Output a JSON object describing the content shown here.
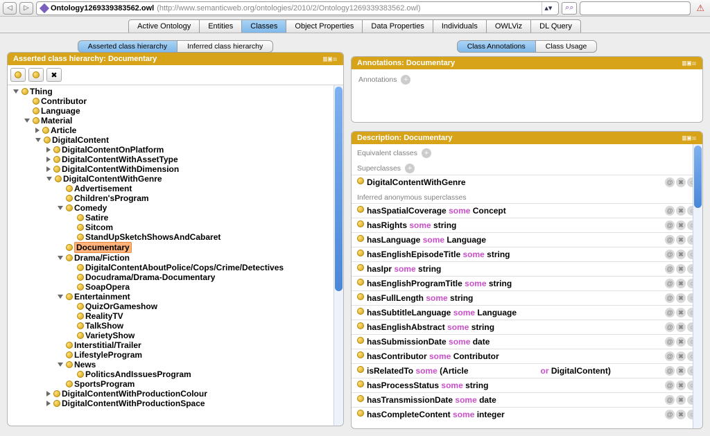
{
  "topbar": {
    "title": "Ontology1269339383562.owl",
    "uri": "(http://www.semanticweb.org/ontologies/2010/2/Ontology1269339383562.owl)"
  },
  "main_tabs": [
    "Active Ontology",
    "Entities",
    "Classes",
    "Object Properties",
    "Data Properties",
    "Individuals",
    "OWLViz",
    "DL Query"
  ],
  "main_tab_selected": 2,
  "left": {
    "subtabs": [
      "Asserted class hierarchy",
      "Inferred class hierarchy"
    ],
    "subtab_selected": 0,
    "panel_title": "Asserted class hierarchy: Documentary",
    "selected": "Documentary",
    "tree": [
      {
        "l": "Thing",
        "d": "open",
        "c": [
          {
            "l": "Contributor",
            "d": "none"
          },
          {
            "l": "Language",
            "d": "none"
          },
          {
            "l": "Material",
            "d": "open",
            "c": [
              {
                "l": "Article",
                "d": "closed"
              },
              {
                "l": "DigitalContent",
                "d": "open",
                "c": [
                  {
                    "l": "DigitalContentOnPlatform",
                    "d": "closed"
                  },
                  {
                    "l": "DigitalContentWithAssetType",
                    "d": "closed"
                  },
                  {
                    "l": "DigitalContentWithDimension",
                    "d": "closed"
                  },
                  {
                    "l": "DigitalContentWithGenre",
                    "d": "open",
                    "c": [
                      {
                        "l": "Advertisement",
                        "d": "none"
                      },
                      {
                        "l": "Children'sProgram",
                        "d": "none"
                      },
                      {
                        "l": "Comedy",
                        "d": "open",
                        "c": [
                          {
                            "l": "Satire",
                            "d": "none"
                          },
                          {
                            "l": "Sitcom",
                            "d": "none"
                          },
                          {
                            "l": "StandUpSketchShowsAndCabaret",
                            "d": "none"
                          }
                        ]
                      },
                      {
                        "l": "Documentary",
                        "d": "none",
                        "sel": true
                      },
                      {
                        "l": "Drama/Fiction",
                        "d": "open",
                        "c": [
                          {
                            "l": "DigitalContentAboutPolice/Cops/Crime/Detectives",
                            "d": "none"
                          },
                          {
                            "l": "Docudrama/Drama-Documentary",
                            "d": "none"
                          },
                          {
                            "l": "SoapOpera",
                            "d": "none"
                          }
                        ]
                      },
                      {
                        "l": "Entertainment",
                        "d": "open",
                        "c": [
                          {
                            "l": "QuizOrGameshow",
                            "d": "none"
                          },
                          {
                            "l": "RealityTV",
                            "d": "none"
                          },
                          {
                            "l": "TalkShow",
                            "d": "none"
                          },
                          {
                            "l": "VarietyShow",
                            "d": "none"
                          }
                        ]
                      },
                      {
                        "l": "Interstitial/Trailer",
                        "d": "none"
                      },
                      {
                        "l": "LifestyleProgram",
                        "d": "none"
                      },
                      {
                        "l": "News",
                        "d": "open",
                        "c": [
                          {
                            "l": "PoliticsAndIssuesProgram",
                            "d": "none"
                          }
                        ]
                      },
                      {
                        "l": "SportsProgram",
                        "d": "none"
                      }
                    ]
                  },
                  {
                    "l": "DigitalContentWithProductionColour",
                    "d": "closed"
                  },
                  {
                    "l": "DigitalContentWithProductionSpace",
                    "d": "closed"
                  }
                ]
              }
            ]
          }
        ]
      }
    ]
  },
  "right": {
    "subtabs": [
      "Class Annotations",
      "Class Usage"
    ],
    "subtab_selected": 0,
    "annot_title": "Annotations: Documentary",
    "annot_section": "Annotations",
    "desc_title": "Description: Documentary",
    "sect_eq": "Equivalent classes",
    "sect_sup": "Superclasses",
    "superclasses": [
      "DigitalContentWithGenre"
    ],
    "sect_inf": "Inferred anonymous superclasses",
    "inferred": [
      [
        [
          "p",
          "hasSpatialCoverage"
        ],
        [
          "k",
          "some"
        ],
        [
          "t",
          "Concept"
        ]
      ],
      [
        [
          "p",
          "hasRights"
        ],
        [
          "k",
          "some"
        ],
        [
          "t",
          "string"
        ]
      ],
      [
        [
          "p",
          "hasLanguage"
        ],
        [
          "k",
          "some"
        ],
        [
          "t",
          "Language"
        ]
      ],
      [
        [
          "p",
          "hasEnglishEpisodeTitle"
        ],
        [
          "k",
          "some"
        ],
        [
          "t",
          "string"
        ]
      ],
      [
        [
          "p",
          "hasIpr"
        ],
        [
          "k",
          "some"
        ],
        [
          "t",
          "string"
        ]
      ],
      [
        [
          "p",
          "hasEnglishProgramTitle"
        ],
        [
          "k",
          "some"
        ],
        [
          "t",
          "string"
        ]
      ],
      [
        [
          "p",
          "hasFullLength"
        ],
        [
          "k",
          "some"
        ],
        [
          "t",
          "string"
        ]
      ],
      [
        [
          "p",
          "hasSubtitleLanguage"
        ],
        [
          "k",
          "some"
        ],
        [
          "t",
          "Language"
        ]
      ],
      [
        [
          "p",
          "hasEnglishAbstract"
        ],
        [
          "k",
          "some"
        ],
        [
          "t",
          "string"
        ]
      ],
      [
        [
          "p",
          "hasSubmissionDate"
        ],
        [
          "k",
          "some"
        ],
        [
          "t",
          "date"
        ]
      ],
      [
        [
          "p",
          "hasContributor"
        ],
        [
          "k",
          "some"
        ],
        [
          "t",
          "Contributor"
        ]
      ],
      [
        [
          "p",
          "isRelatedTo"
        ],
        [
          "k",
          "some"
        ],
        [
          "t",
          "(Article"
        ],
        [
          "br",
          ""
        ],
        [
          "k",
          "or"
        ],
        [
          "t",
          "DigitalContent)"
        ]
      ],
      [
        [
          "p",
          "hasProcessStatus"
        ],
        [
          "k",
          "some"
        ],
        [
          "t",
          "string"
        ]
      ],
      [
        [
          "p",
          "hasTransmissionDate"
        ],
        [
          "k",
          "some"
        ],
        [
          "t",
          "date"
        ]
      ],
      [
        [
          "p",
          "hasCompleteContent"
        ],
        [
          "k",
          "some"
        ],
        [
          "t",
          "integer"
        ]
      ]
    ]
  }
}
